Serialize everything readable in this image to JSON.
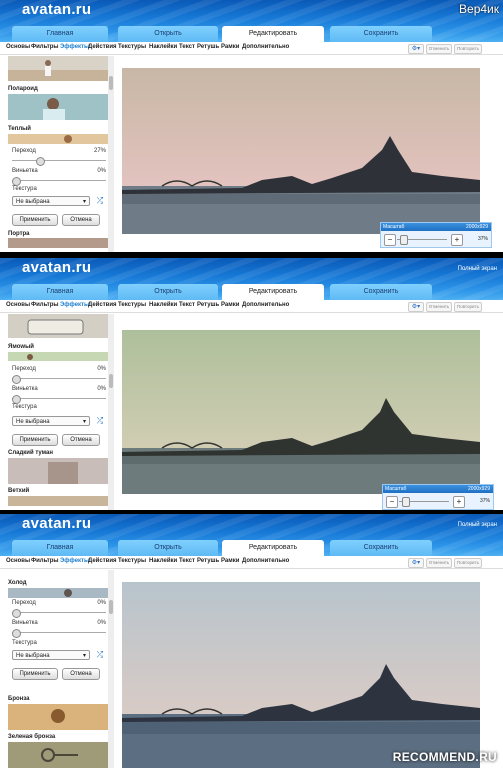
{
  "app": {
    "logo": "avatan.ru"
  },
  "top_label": "Вер4ик",
  "fullscreen_label": "Полный экран",
  "tabs": [
    "Главная",
    "Открыть",
    "Редактировать",
    "Сохранить"
  ],
  "submenu": [
    "Основы",
    "Фильтры",
    "Эффекты",
    "Действия",
    "Текстуры",
    "Наклейки",
    "Текст",
    "Ретушь",
    "Рамки",
    "Дополнительно"
  ],
  "toolbar": {
    "undo": "Отменить",
    "redo": "Повторить"
  },
  "controls": {
    "transition_label": "Переход",
    "vignette_label": "Виньетка",
    "texture_label": "Текстура",
    "texture_value": "Не выбрана",
    "apply_label": "Применить",
    "cancel_label": "Отмена"
  },
  "scale": {
    "label": "Масштаб",
    "dimensions": "2000x929",
    "percent": "37%"
  },
  "panel1": {
    "effect_prev": "Полароид",
    "effect_current": "Теплый",
    "transition_value": "27%",
    "transition_fraction": 0.27,
    "vignette_value": "0%",
    "effect_next": "Портра"
  },
  "panel2": {
    "effect_current": "Ямowый",
    "transition_value": "0%",
    "vignette_value": "0%",
    "effect_next": "Сладкий туман",
    "effect_next2": "Ветхий"
  },
  "panel3": {
    "effect_current": "Холод",
    "transition_value": "0%",
    "vignette_value": "0%",
    "effect_next": "Бронза",
    "effect_next2": "Зеленая бронза"
  },
  "watermark": "RECOMMEND.RU",
  "colors": {
    "accent": "#1f6fc2",
    "header_top": "#0a59b7",
    "tab": "#6cc4fa"
  }
}
